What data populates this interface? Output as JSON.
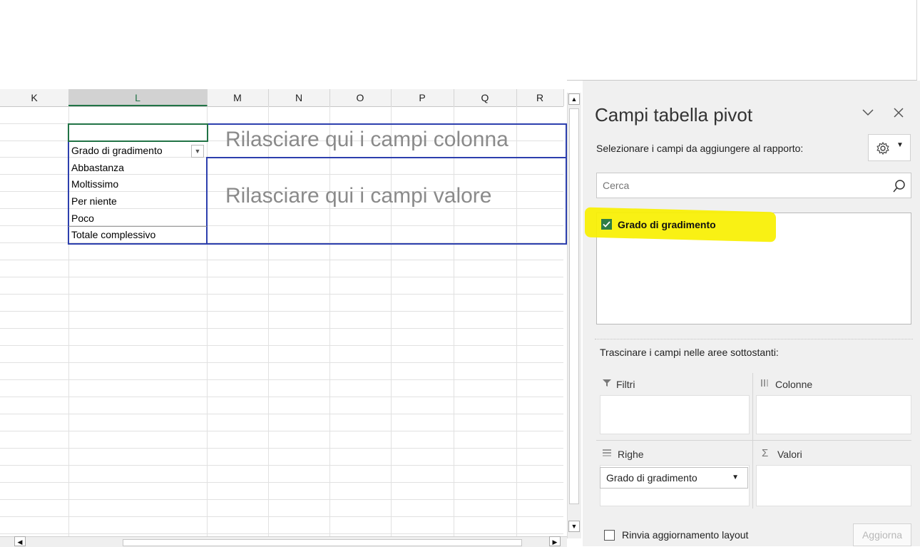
{
  "columns": [
    "K",
    "L",
    "M",
    "N",
    "O",
    "P",
    "Q",
    "R"
  ],
  "selected_column": "L",
  "pivot": {
    "row_header": "Grado di gradimento",
    "rows": [
      "Abbastanza",
      "Moltissimo",
      "Per niente",
      "Poco",
      "Totale complessivo"
    ],
    "drop_columns": "Rilasciare qui i campi colonna",
    "drop_values": "Rilasciare qui i campi valore"
  },
  "pane": {
    "title": "Campi tabella pivot",
    "subtitle": "Selezionare i campi da aggiungere al rapporto:",
    "search_placeholder": "Cerca",
    "fields": [
      {
        "label": "Grado di gradimento",
        "checked": true
      }
    ],
    "drag_hint": "Trascinare i campi nelle aree sottostanti:",
    "areas": {
      "filters": "Filtri",
      "columns": "Colonne",
      "rows": "Righe",
      "values": "Valori"
    },
    "rows_chip": "Grado di gradimento",
    "defer_label": "Rinvia aggiornamento layout",
    "update_button": "Aggiorna"
  },
  "colors": {
    "highlight": "#f8f000",
    "pivot_border": "#2d3fae",
    "excel_green": "#217346"
  }
}
